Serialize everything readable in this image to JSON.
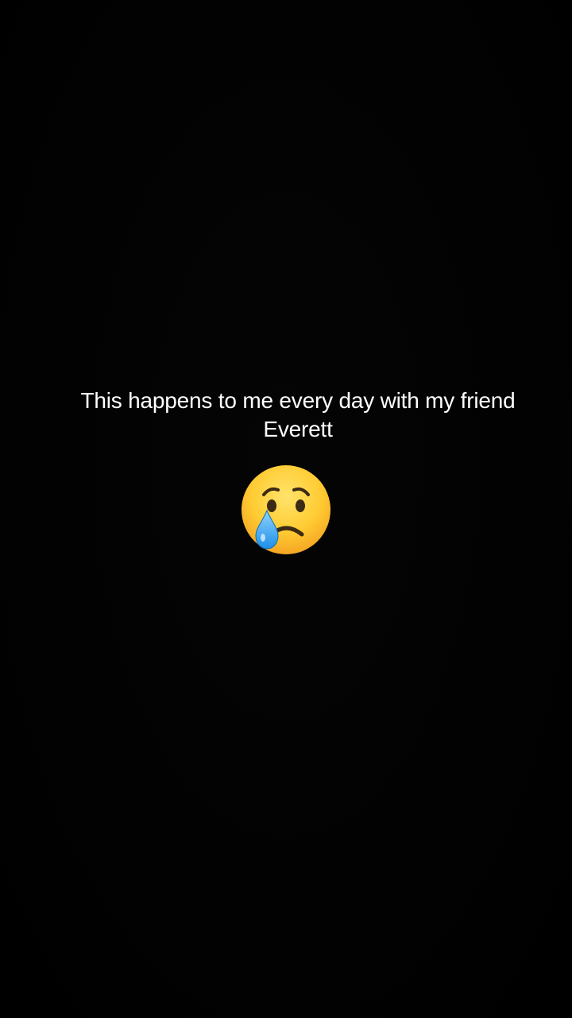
{
  "caption": {
    "text": "This happens to me every day with my friend\nEverett"
  },
  "emoji": {
    "icon": "crying-face-icon",
    "colors": {
      "face_light": "#ffd84a",
      "face_dark": "#f5a623",
      "features": "#3b2a14",
      "tear": "#4fb3ff"
    }
  },
  "background": {
    "color": "#030303"
  }
}
